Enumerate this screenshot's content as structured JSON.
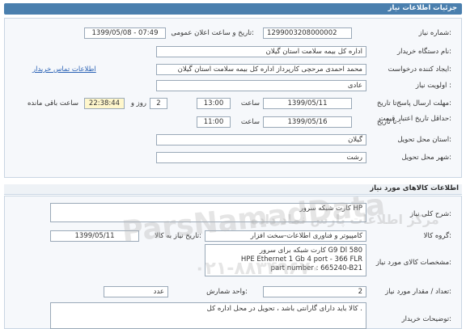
{
  "header": {
    "title": "جزئیات اطلاعات نیاز"
  },
  "details": {
    "need_number_label": "شماره نیاز:",
    "need_number": "1299003208000002",
    "announce_label": "تاریخ و ساعت اعلان عمومی:",
    "announce_value": "1399/05/08 - 07:49",
    "buyer_org_label": "نام دستگاه خریدار:",
    "buyer_org": "اداره کل بیمه سلامت استان گیلان",
    "requester_label": "ایجاد کننده درخواست:",
    "requester": "محمد احمدی مرحچی کارپرداز اداره کل بیمه سلامت استان گیلان",
    "contact_link": "اطلاعات تماس خریدار",
    "priority_label": "اولویت نیاز :",
    "priority": "عادی",
    "deadline_label": "مهلت ارسال پاسخ:",
    "deadline_to": "تا تاریخ :",
    "deadline_date": "1399/05/11",
    "deadline_hour_label": "ساعت",
    "deadline_hour": "13:00",
    "days": "2",
    "day_label": "روز و",
    "remaining_time": "22:38:44",
    "remaining_label": "ساعت باقی مانده",
    "min_price_label": "حداقل تاریخ اعتبار قیمت:",
    "price_to": "تا تاریخ :",
    "price_date": "1399/05/16",
    "price_hour_label": "ساعت",
    "price_hour": "11:00",
    "province_label": "استان محل تحویل:",
    "province": "گیلان",
    "city_label": "شهر محل تحویل:",
    "city": "رشت"
  },
  "goods": {
    "section_title": "اطلاعات کالاهای مورد نیاز",
    "summary_label": "شرح کلی نیاز:",
    "summary": "کارت شبکه سرور HP",
    "group_label": "گروه کالا:",
    "group": "کامپیوتر و فناوری اطلاعات-سخت افزار",
    "need_date_label": "تاریخ نیاز به کالا:",
    "need_date": "1399/05/11",
    "spec_label": "مشخصات کالای مورد نیاز:",
    "spec_lines": [
      "کارت شبکه برای سرور G9 Dl 580",
      "HPE Ethernet 1 Gb 4 port - 366 FLR",
      "part number : 665240-B21"
    ],
    "qty_label": "تعداد / مقدار مورد نیاز:",
    "qty": "2",
    "unit_label": "واحد شمارش:",
    "unit": "عدد",
    "buyer_notes_label": "توضیحات خریدار:",
    "buyer_notes": "کالا باید دارای گارانتی باشد ، تحویل در محل اداره کل ."
  },
  "watermark": {
    "line1": "ParsNamadData",
    "line2": "مرکز اطلاعات پارس نماد داده",
    "line3": "۰۲۱-۸۸۳۴۹۶۷۰"
  }
}
